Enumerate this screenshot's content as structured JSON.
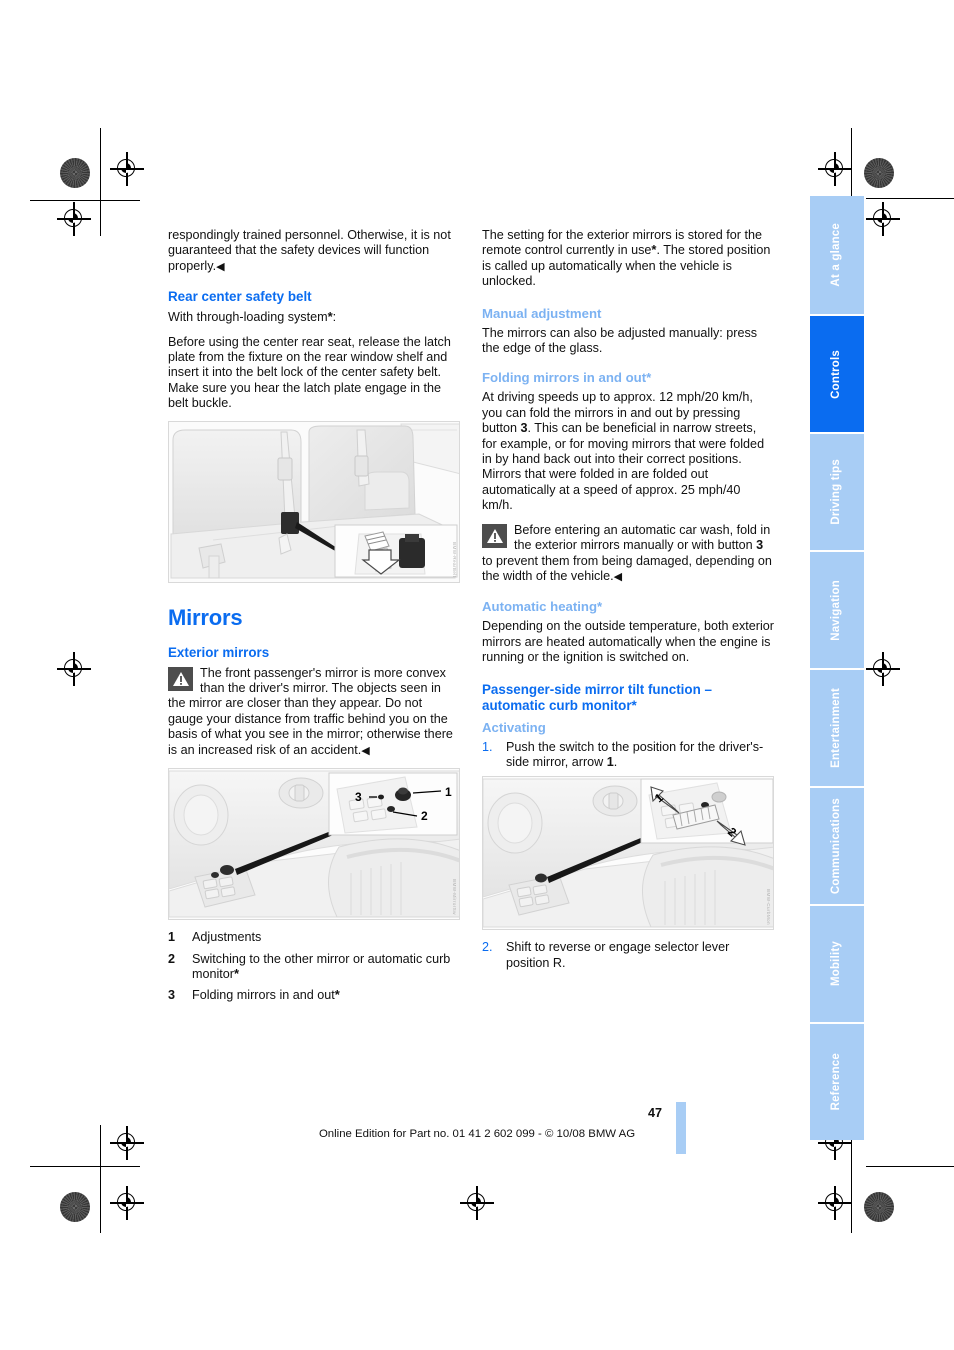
{
  "document": {
    "page_number": "47",
    "footer": "Online Edition for Part no. 01 41 2 602 099 - © 10/08 BMW AG"
  },
  "side_tabs": [
    {
      "label": "At a glance",
      "active": false
    },
    {
      "label": "Controls",
      "active": true
    },
    {
      "label": "Driving tips",
      "active": false
    },
    {
      "label": "Navigation",
      "active": false
    },
    {
      "label": "Entertainment",
      "active": false
    },
    {
      "label": "Communications",
      "active": false
    },
    {
      "label": "Mobility",
      "active": false
    },
    {
      "label": "Reference",
      "active": false
    }
  ],
  "left_column": {
    "continued_paragraph": "respondingly trained personnel. Otherwise, it is not guaranteed that the safety devices will function properly.",
    "heading_rear_belt": "Rear center safety belt",
    "through_loading": "With through-loading system",
    "through_loading_suffix": ":",
    "rear_belt_body": "Before using the center rear seat, release the latch plate from the fixture on the rear window shelf and insert it into the belt lock of the center safety belt. Make sure you hear the latch plate engage in the belt buckle.",
    "figure_rear_seat": {
      "name": "rear-seat-belt-illustration",
      "code": "BMW-RearBelt"
    },
    "section_title": "Mirrors",
    "heading_exterior": "Exterior mirrors",
    "warning_exterior": "The front passenger's mirror is more convex than the driver's mirror. The objects seen in the mirror are closer than they appear. Do not gauge your distance from traffic behind you on the basis of what you see in the mirror; otherwise there is an increased risk of an accident.",
    "figure_mirror_switch": {
      "name": "mirror-switch-illustration",
      "code": "BMW-MirrorSw",
      "callouts": [
        "1",
        "2",
        "3"
      ]
    },
    "legend": [
      {
        "num": "1",
        "text": "Adjustments"
      },
      {
        "num": "2",
        "text": "Switching to the other mirror or automatic curb monitor",
        "star": true
      },
      {
        "num": "3",
        "text": "Folding mirrors in and out",
        "star": true
      }
    ]
  },
  "right_column": {
    "stored_setting_a": "The setting for the exterior mirrors is stored for the remote control currently in use",
    "stored_setting_b": ". The stored position is called up automatically when the vehicle is unlocked.",
    "heading_manual": "Manual adjustment",
    "manual_body": "The mirrors can also be adjusted manually: press the edge of the glass.",
    "heading_folding": "Folding mirrors in and out*",
    "folding_body_1": "At driving speeds up to approx. 12 mph/20 km/h, you can fold the mirrors in and out by pressing button ",
    "folding_button": "3",
    "folding_body_2": ". This can be beneficial in narrow streets, for example, or for moving mirrors that were folded in by hand back out into their correct positions. Mirrors that were folded in are folded out automatically at a speed of approx. 25 mph/40 km/h.",
    "warning_carwash_1": "Before entering an automatic car wash, fold in the exterior mirrors manually or with button ",
    "warning_carwash_button": "3",
    "warning_carwash_2": " to prevent them from being damaged, depending on the width of the vehicle.",
    "heading_heating": "Automatic heating*",
    "heating_body": "Depending on the outside temperature, both exterior mirrors are heated automatically when the engine is running or the ignition is switched on.",
    "heading_tilt": "Passenger-side mirror tilt function – automatic curb monitor*",
    "heading_activating": "Activating",
    "steps": [
      {
        "num": "1.",
        "text_a": "Push the switch to the position for the driver's-side mirror, arrow ",
        "bold": "1",
        "text_b": "."
      },
      {
        "num": "2.",
        "text_a": "Shift to reverse or engage selector lever position R.",
        "bold": "",
        "text_b": ""
      }
    ],
    "figure_curb_monitor": {
      "name": "curb-monitor-illustration",
      "code": "BMW-CurbMon",
      "arrows": [
        "1",
        "2"
      ]
    }
  },
  "colors": {
    "heading_blue": "#0a6cf0",
    "subheading_blue": "#7cb2f2",
    "tab_inactive": "#a8cdf5",
    "tab_active": "#0a6cf0"
  },
  "icons": {
    "warning": "warning-triangle-icon",
    "endmark": "◀",
    "star": "*"
  }
}
